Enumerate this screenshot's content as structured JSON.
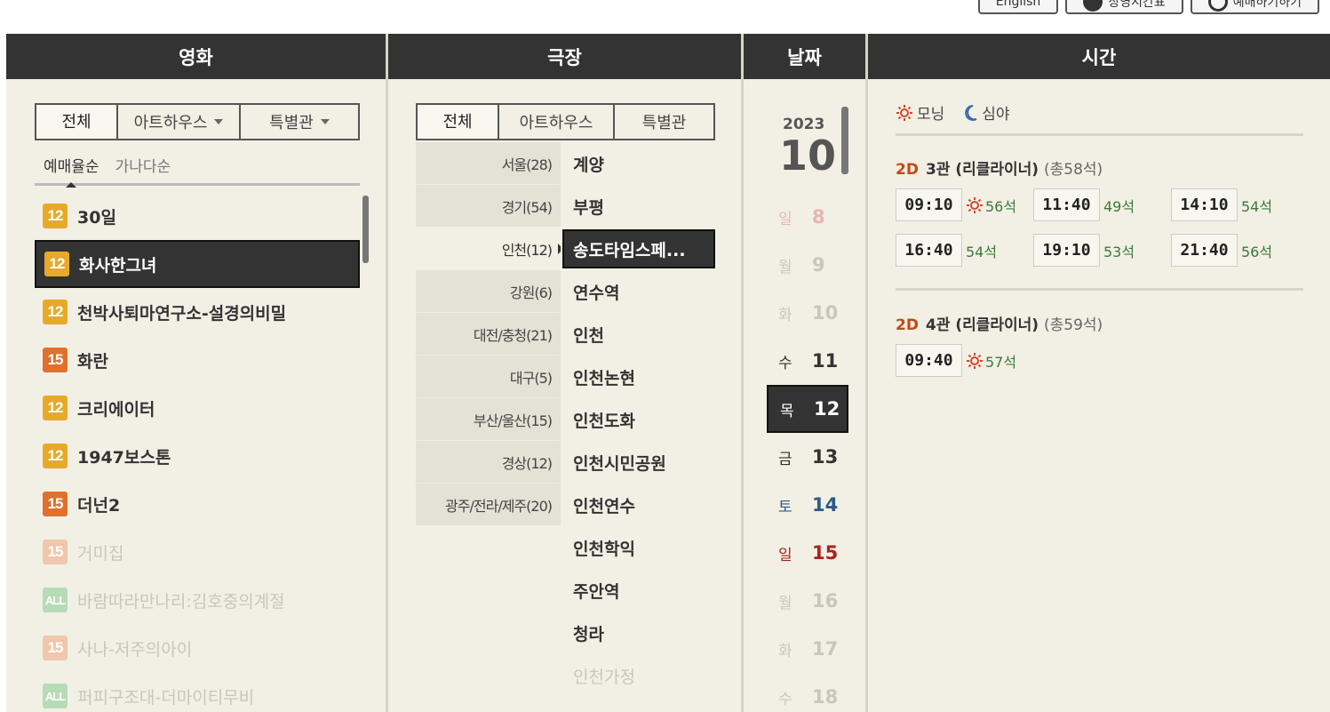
{
  "top_buttons": [
    "English",
    "상영시간표",
    "예매하기하기"
  ],
  "columns": {
    "movie": "영화",
    "theater": "극장",
    "date": "날짜",
    "time": "시간"
  },
  "movie_tabs": [
    {
      "label": "전체",
      "active": true,
      "dropdown": false
    },
    {
      "label": "아트하우스",
      "active": false,
      "dropdown": true
    },
    {
      "label": "특별관",
      "active": false,
      "dropdown": true
    }
  ],
  "sort_tabs": [
    {
      "label": "예매율순",
      "active": true
    },
    {
      "label": "가나다순",
      "active": false
    }
  ],
  "movies": [
    {
      "rating": "12",
      "title": "30일",
      "state": "normal"
    },
    {
      "rating": "12",
      "title": "화사한그녀",
      "state": "selected"
    },
    {
      "rating": "12",
      "title": "천박사퇴마연구소-설경의비밀",
      "state": "normal"
    },
    {
      "rating": "15",
      "title": "화란",
      "state": "normal"
    },
    {
      "rating": "12",
      "title": "크리에이터",
      "state": "normal"
    },
    {
      "rating": "12",
      "title": "1947보스톤",
      "state": "normal"
    },
    {
      "rating": "15",
      "title": "더넌2",
      "state": "normal"
    },
    {
      "rating": "15",
      "title": "거미집",
      "state": "dim"
    },
    {
      "rating": "ALL",
      "title": "바람따라만나리:김호중의계절",
      "state": "dim"
    },
    {
      "rating": "15",
      "title": "사나-저주의아이",
      "state": "dim"
    },
    {
      "rating": "ALL",
      "title": "퍼피구조대-더마이티무비",
      "state": "dim"
    }
  ],
  "theater_tabs": [
    {
      "label": "전체",
      "active": true
    },
    {
      "label": "아트하우스",
      "active": false
    },
    {
      "label": "특별관",
      "active": false
    }
  ],
  "regions": [
    {
      "label": "서울(28)",
      "active": false
    },
    {
      "label": "경기(54)",
      "active": false
    },
    {
      "label": "인천(12)",
      "active": true
    },
    {
      "label": "강원(6)",
      "active": false
    },
    {
      "label": "대전/충청(21)",
      "active": false
    },
    {
      "label": "대구(5)",
      "active": false
    },
    {
      "label": "부산/울산(15)",
      "active": false
    },
    {
      "label": "경상(12)",
      "active": false
    },
    {
      "label": "광주/전라/제주(20)",
      "active": false
    }
  ],
  "theaters": [
    {
      "name": "계양",
      "state": "normal"
    },
    {
      "name": "부평",
      "state": "normal"
    },
    {
      "name": "송도타임스페...",
      "state": "selected"
    },
    {
      "name": "연수역",
      "state": "normal"
    },
    {
      "name": "인천",
      "state": "normal"
    },
    {
      "name": "인천논현",
      "state": "normal"
    },
    {
      "name": "인천도화",
      "state": "normal"
    },
    {
      "name": "인천시민공원",
      "state": "normal"
    },
    {
      "name": "인천연수",
      "state": "normal"
    },
    {
      "name": "인천학익",
      "state": "normal"
    },
    {
      "name": "주안역",
      "state": "normal"
    },
    {
      "name": "청라",
      "state": "normal"
    },
    {
      "name": "인천가정",
      "state": "dim"
    }
  ],
  "date": {
    "year": "2023",
    "month": "10",
    "days": [
      {
        "weekday": "일",
        "day": "8",
        "state": "past-sun"
      },
      {
        "weekday": "월",
        "day": "9",
        "state": "past"
      },
      {
        "weekday": "화",
        "day": "10",
        "state": "past"
      },
      {
        "weekday": "수",
        "day": "11",
        "state": "normal"
      },
      {
        "weekday": "목",
        "day": "12",
        "state": "selected"
      },
      {
        "weekday": "금",
        "day": "13",
        "state": "normal"
      },
      {
        "weekday": "토",
        "day": "14",
        "state": "sat"
      },
      {
        "weekday": "일",
        "day": "15",
        "state": "sun"
      },
      {
        "weekday": "월",
        "day": "16",
        "state": "past"
      },
      {
        "weekday": "화",
        "day": "17",
        "state": "past"
      },
      {
        "weekday": "수",
        "day": "18",
        "state": "past"
      }
    ]
  },
  "legend": {
    "morning": "모닝",
    "night": "심야"
  },
  "halls": [
    {
      "format": "2D",
      "name": "3관 (리클라이너)",
      "seats": "(총58석)",
      "showtimes": [
        {
          "time": "09:10",
          "seats": "56석",
          "morning": true
        },
        {
          "time": "11:40",
          "seats": "49석",
          "morning": false
        },
        {
          "time": "14:10",
          "seats": "54석",
          "morning": false
        },
        {
          "time": "16:40",
          "seats": "54석",
          "morning": false
        },
        {
          "time": "19:10",
          "seats": "53석",
          "morning": false
        },
        {
          "time": "21:40",
          "seats": "56석",
          "morning": false
        }
      ]
    },
    {
      "format": "2D",
      "name": "4관 (리클라이너)",
      "seats": "(총59석)",
      "showtimes": [
        {
          "time": "09:40",
          "seats": "57석",
          "morning": true
        }
      ]
    }
  ],
  "colors": {
    "header_bg": "#333333",
    "panel_bg": "#f2f0e5",
    "rating_12": "#e7a92a",
    "rating_15": "#e0702a",
    "rating_all": "#4aa84d",
    "format_2d": "#c04a18",
    "seats_green": "#3a7a35",
    "saturday": "#2a5a8a",
    "sunday": "#a8231f"
  }
}
